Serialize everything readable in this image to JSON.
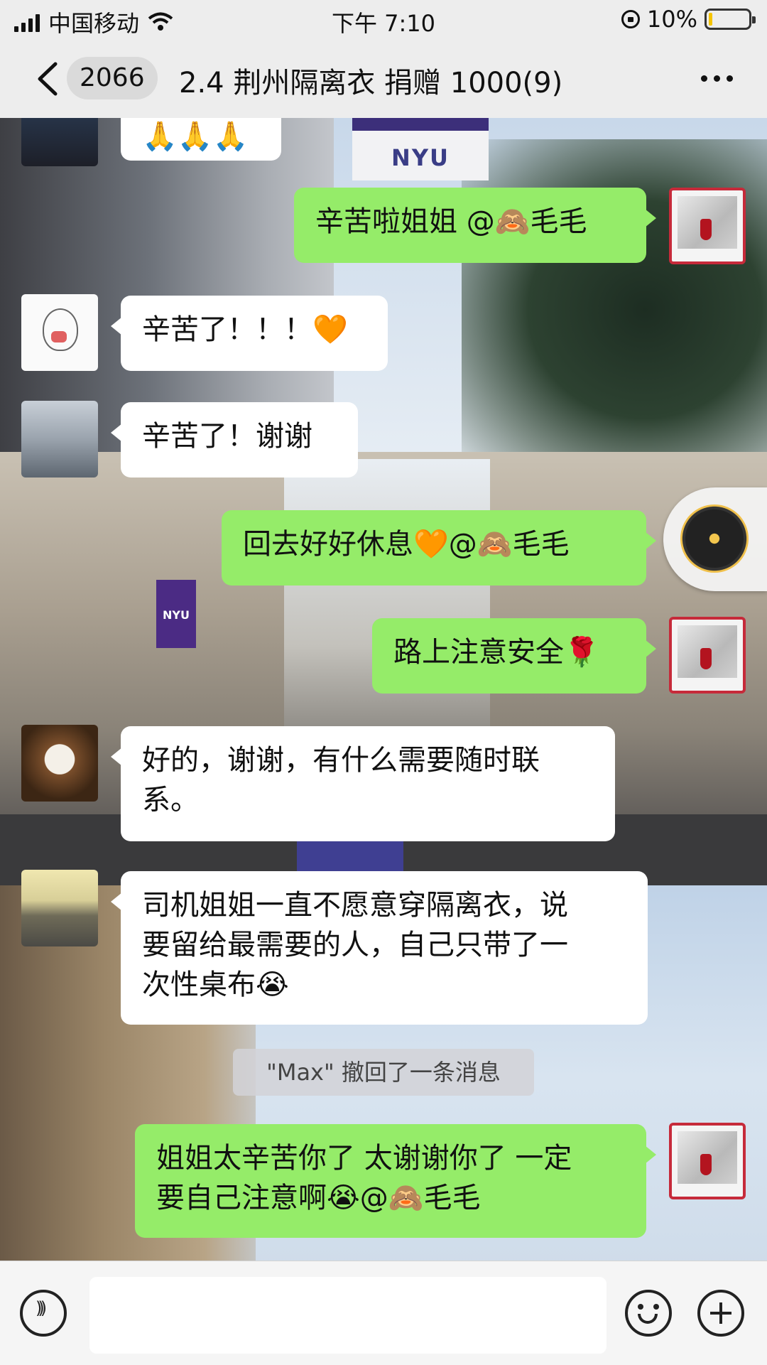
{
  "status_bar": {
    "carrier": "中国移动",
    "time": "下午 7:10",
    "battery_percent": "10%",
    "battery_level": 0.1
  },
  "header": {
    "unread_count": "2066",
    "title": "2.4 荆州隔离衣 捐赠 1000(9)"
  },
  "messages": [
    {
      "side": "left",
      "text": "🙏🙏🙏"
    },
    {
      "side": "right",
      "text": "辛苦啦姐姐 @🙈毛毛"
    },
    {
      "side": "left",
      "text": "辛苦了！！！🧡"
    },
    {
      "side": "left",
      "text": "辛苦了！谢谢"
    },
    {
      "side": "right",
      "text": "回去好好休息🧡@🙈毛毛"
    },
    {
      "side": "right",
      "text": "路上注意安全🌹"
    },
    {
      "side": "left",
      "text": "好的，谢谢，有什么需要随时联\n系。"
    },
    {
      "side": "left",
      "text": "司机姐姐一直不愿意穿隔离衣，说\n要留给最需要的人，自己只带了一\n次性桌布😭"
    },
    {
      "side": "right",
      "text": "姐姐太辛苦你了 太谢谢你了 一定\n要自己注意啊😭@🙈毛毛"
    }
  ],
  "system_notice": "\"Max\" 撤回了一条消息",
  "background": {
    "flag_text": "NYU",
    "flag_text_small": "NYU"
  },
  "icons": {
    "back": "chevron-left-icon",
    "more": "more-dots-icon",
    "voice": "voice-icon",
    "emoji": "emoji-icon",
    "plus": "plus-icon",
    "music": "music-disc-icon"
  },
  "colors": {
    "bubble_self": "#95ec69",
    "bubble_other": "#ffffff",
    "header_bg": "#ededed"
  }
}
